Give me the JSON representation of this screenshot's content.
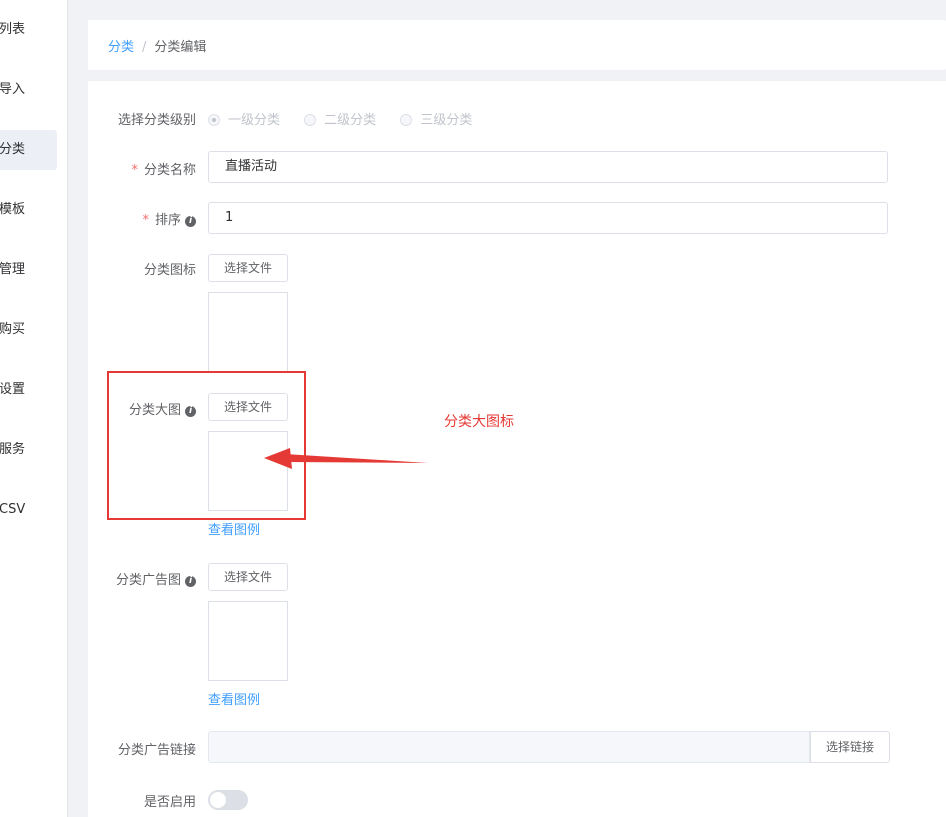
{
  "sidebar": {
    "items": [
      {
        "label": "列表",
        "active": false
      },
      {
        "label": "导入",
        "active": false
      },
      {
        "label": "分类",
        "active": true
      },
      {
        "label": "模板",
        "active": false
      },
      {
        "label": "管理",
        "active": false
      },
      {
        "label": "购买",
        "active": false
      },
      {
        "label": "设置",
        "active": false
      },
      {
        "label": "服务",
        "active": false
      },
      {
        "label": "CSV",
        "active": false
      }
    ]
  },
  "breadcrumb": {
    "parent": "分类",
    "separator": "/",
    "current": "分类编辑"
  },
  "form": {
    "level": {
      "label": "选择分类级别",
      "options": [
        "一级分类",
        "二级分类",
        "三级分类"
      ],
      "selected": "一级分类"
    },
    "name": {
      "required_mark": "*",
      "label": "分类名称",
      "value": "直播活动"
    },
    "sort": {
      "required_mark": "*",
      "label": "排序",
      "value": "1"
    },
    "icon": {
      "label": "分类图标",
      "button": "选择文件"
    },
    "big_image": {
      "label": "分类大图",
      "button": "选择文件",
      "example_link": "查看图例"
    },
    "ad_image": {
      "label": "分类广告图",
      "button": "选择文件",
      "example_link": "查看图例"
    },
    "ad_link": {
      "label": "分类广告链接",
      "value": "",
      "button": "选择链接"
    },
    "enabled": {
      "label": "是否启用",
      "value": false
    }
  },
  "annotation": {
    "text": "分类大图标",
    "color": "#e53935"
  },
  "colors": {
    "accent": "#409eff",
    "required": "#f56c6c",
    "annotation": "#e53935"
  }
}
